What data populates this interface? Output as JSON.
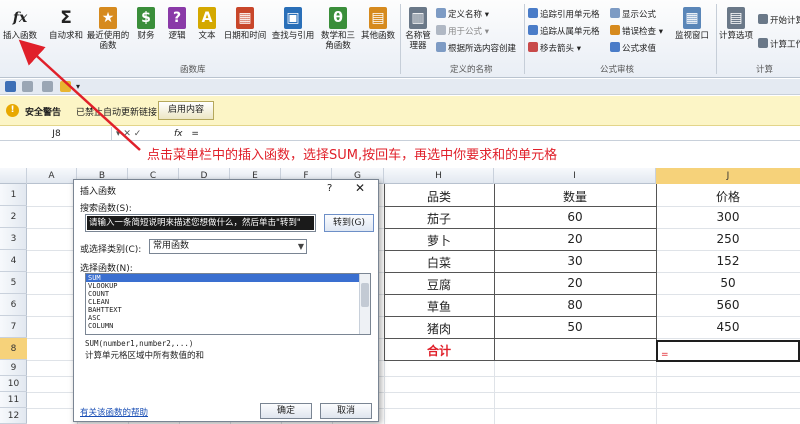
{
  "ribbon": {
    "buttons": [
      {
        "label": "插入函数",
        "glyph": "fx",
        "color": "#ffffff"
      },
      {
        "label": "自动求和",
        "glyph": "Σ",
        "color": "#ffffff"
      },
      {
        "label": "最近使用的函数",
        "glyph": "★",
        "color": "#d68a1e"
      },
      {
        "label": "财务",
        "glyph": "$",
        "color": "#3a8e3a"
      },
      {
        "label": "逻辑",
        "glyph": "?",
        "color": "#8a3aa8"
      },
      {
        "label": "文本",
        "glyph": "A",
        "color": "#d4a800"
      },
      {
        "label": "日期和时间",
        "glyph": "▦",
        "color": "#c8462a"
      },
      {
        "label": "查找与引用",
        "glyph": "▣",
        "color": "#2a6fb8"
      },
      {
        "label": "数学和三角函数",
        "glyph": "θ",
        "color": "#3a8e3a"
      },
      {
        "label": "其他函数",
        "glyph": "▤",
        "color": "#d68a1e"
      },
      {
        "label": "名称管理器",
        "glyph": "▥",
        "color": "#6a7888"
      }
    ],
    "defined_names": [
      "定义名称 ▾",
      "用于公式 ▾",
      "根据所选内容创建"
    ],
    "auditing": [
      "追踪引用单元格",
      "追踪从属单元格",
      "移去箭头 ▾",
      "显示公式",
      "错误检查 ▾",
      "公式求值"
    ],
    "watch": "监视窗口",
    "calc_options": "计算选项",
    "calc": [
      "开始计算",
      "计算工作表"
    ],
    "groups": [
      "函数库",
      "定义的名称",
      "公式审核",
      "计算"
    ]
  },
  "security": {
    "title": "安全警告",
    "message": "已禁止自动更新链接",
    "enable_button": "启用内容"
  },
  "formula_bar": {
    "name_box": "J8",
    "icons": "▾  ✕ ✓",
    "fx": "fx",
    "value": "="
  },
  "annotation": "点击菜单栏中的插入函数，选择SUM,按回车，再选中你要求和的单元格",
  "columns": [
    "A",
    "B",
    "C",
    "D",
    "E",
    "F",
    "G",
    "H",
    "I",
    "J"
  ],
  "rows": [
    "1",
    "2",
    "3",
    "4",
    "5",
    "6",
    "7",
    "8",
    "9",
    "10",
    "11",
    "12"
  ],
  "table": {
    "headers": [
      "品类",
      "数量",
      "价格"
    ],
    "rows": [
      [
        "茄子",
        "60",
        "300"
      ],
      [
        "萝卜",
        "20",
        "250"
      ],
      [
        "白菜",
        "30",
        "152"
      ],
      [
        "豆腐",
        "20",
        "50"
      ],
      [
        "草鱼",
        "80",
        "560"
      ],
      [
        "猪肉",
        "50",
        "450"
      ]
    ],
    "total_label": "合计",
    "active_value": "="
  },
  "dialog": {
    "title": "插入函数",
    "help": "?",
    "close": "✕",
    "search_label": "搜索函数(S):",
    "search_text": "请输入一条简短说明来描述您想做什么，然后单击\"转到\"",
    "goto_button": "转到(G)",
    "category_label": "或选择类别(C):",
    "category_value": "常用函数",
    "function_label": "选择函数(N):",
    "functions": [
      "SUM",
      "VLOOKUP",
      "COUNT",
      "CLEAN",
      "BAHTTEXT",
      "ASC",
      "COLUMN"
    ],
    "selected_function": "SUM",
    "syntax": "SUM(number1,number2,...)",
    "description": "计算单元格区域中所有数值的和",
    "help_link": "有关该函数的帮助",
    "ok_button": "确定",
    "cancel_button": "取消"
  },
  "colors": {
    "accent_red": "#e0202a",
    "selection": "#f6d27a"
  }
}
